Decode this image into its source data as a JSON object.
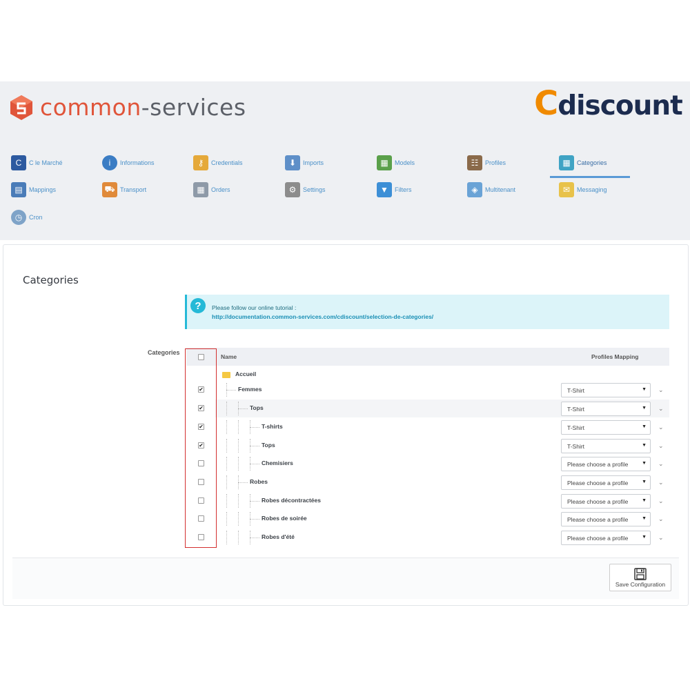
{
  "brand": {
    "name_part1": "common",
    "name_part2": "-services",
    "partner": "discount",
    "partner_letter": "C"
  },
  "menu": [
    {
      "label": "C le Marché",
      "icon": "cdiscount-icon",
      "color": "#2d5aa0"
    },
    {
      "label": "Informations",
      "icon": "info-icon",
      "color": "#3b7dc4"
    },
    {
      "label": "Credentials",
      "icon": "key-icon",
      "color": "#e5a93a"
    },
    {
      "label": "Imports",
      "icon": "import-icon",
      "color": "#5e8fc8"
    },
    {
      "label": "Models",
      "icon": "models-icon",
      "color": "#5aa04a"
    },
    {
      "label": "Profiles",
      "icon": "profiles-icon",
      "color": "#8a6a4a"
    },
    {
      "label": "Categories",
      "icon": "categories-icon",
      "color": "#3fa3c4"
    },
    {
      "label": "Mappings",
      "icon": "mappings-icon",
      "color": "#4a7cb8"
    },
    {
      "label": "Transport",
      "icon": "truck-icon",
      "color": "#e08a3a"
    },
    {
      "label": "Orders",
      "icon": "orders-icon",
      "color": "#8e9aa8"
    },
    {
      "label": "Settings",
      "icon": "gear-icon",
      "color": "#8c8c8c"
    },
    {
      "label": "Filters",
      "icon": "funnel-icon",
      "color": "#3d8fd6"
    },
    {
      "label": "Multitenant",
      "icon": "tags-icon",
      "color": "#6aa3d6"
    },
    {
      "label": "Messaging",
      "icon": "envelope-icon",
      "color": "#e8c24a"
    },
    {
      "label": "Cron",
      "icon": "clock-icon",
      "color": "#7ea3c8"
    }
  ],
  "page": {
    "title": "Categories"
  },
  "info": {
    "text": "Please follow our online tutorial :",
    "link": "http://documentation.common-services.com/cdiscount/selection-de-categories/"
  },
  "table": {
    "side_label": "Categories",
    "col_name": "Name",
    "col_profiles": "Profiles Mapping",
    "root": "Accueil",
    "rows": [
      {
        "name": "Femmes",
        "checked": true,
        "profile": "T-Shirt"
      },
      {
        "name": "Tops",
        "checked": true,
        "profile": "T-Shirt"
      },
      {
        "name": "T-shirts",
        "checked": true,
        "profile": "T-Shirt"
      },
      {
        "name": "Tops",
        "checked": true,
        "profile": "T-Shirt"
      },
      {
        "name": "Chemisiers",
        "checked": false,
        "profile": "Please choose a profile"
      },
      {
        "name": "Robes",
        "checked": false,
        "profile": "Please choose a profile"
      },
      {
        "name": "Robes décontractées",
        "checked": false,
        "profile": "Please choose a profile"
      },
      {
        "name": "Robes de soirée",
        "checked": false,
        "profile": "Please choose a profile"
      },
      {
        "name": "Robes d'été",
        "checked": false,
        "profile": "Please choose a profile"
      }
    ]
  },
  "footer": {
    "save_label": "Save Configuration"
  }
}
